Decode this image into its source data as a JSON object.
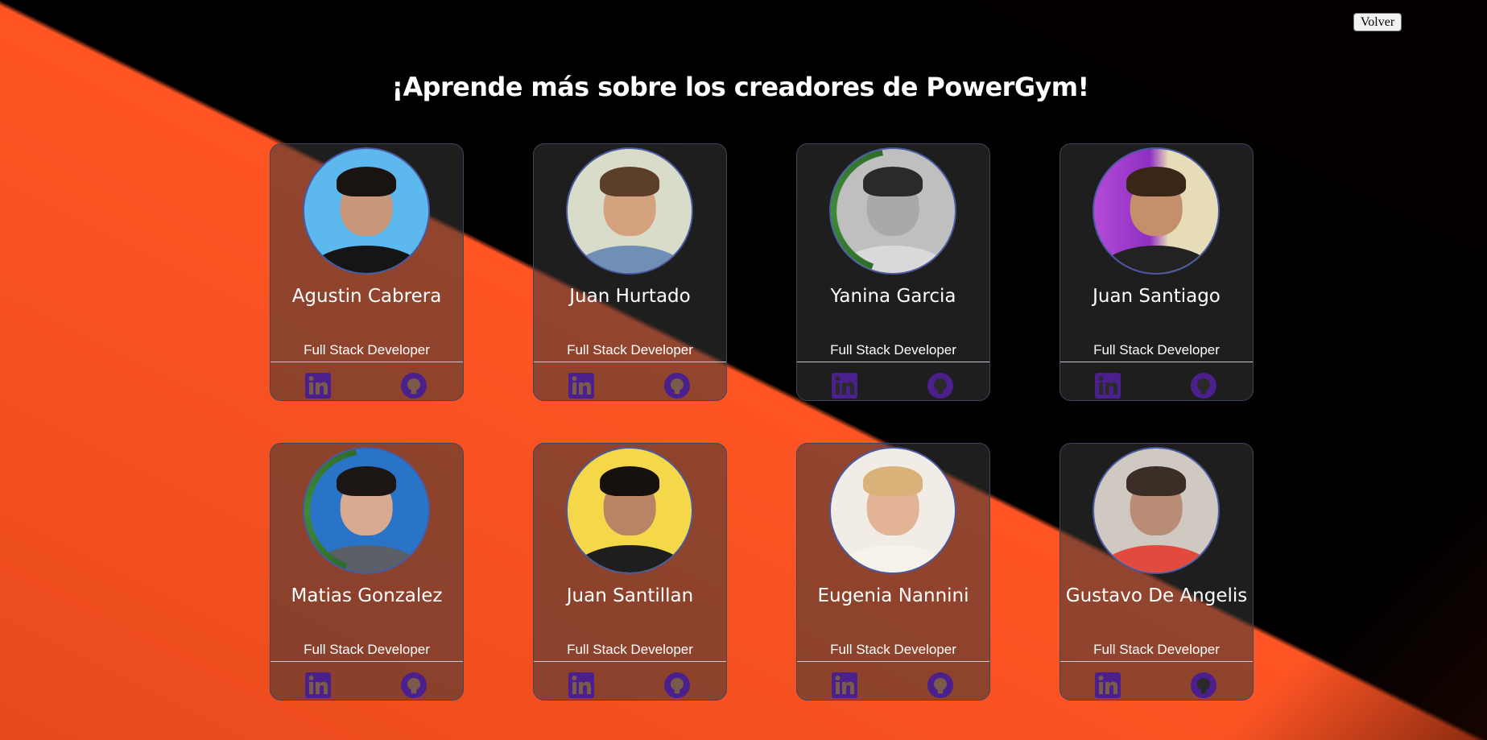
{
  "header": {
    "back_button": "Volver",
    "title": "¡Aprende más sobre los creadores de PowerGym!"
  },
  "colors": {
    "accent_orange": "#ff5524",
    "background_dark": "#000000",
    "social_icon": "#4b1f8c"
  },
  "icons": {
    "linkedin": "linkedin-icon",
    "github": "github-icon"
  },
  "creators": [
    {
      "name": "Agustin Cabrera",
      "role": "Full Stack Developer"
    },
    {
      "name": "Juan Hurtado",
      "role": "Full Stack Developer"
    },
    {
      "name": "Yanina Garcia",
      "role": "Full Stack Developer"
    },
    {
      "name": "Juan Santiago",
      "role": "Full Stack Developer"
    },
    {
      "name": "Matias Gonzalez",
      "role": "Full Stack Developer"
    },
    {
      "name": "Juan Santillan",
      "role": "Full Stack Developer"
    },
    {
      "name": "Eugenia Nannini",
      "role": "Full Stack Developer"
    },
    {
      "name": "Gustavo De Angelis",
      "role": "Full Stack Developer"
    }
  ]
}
